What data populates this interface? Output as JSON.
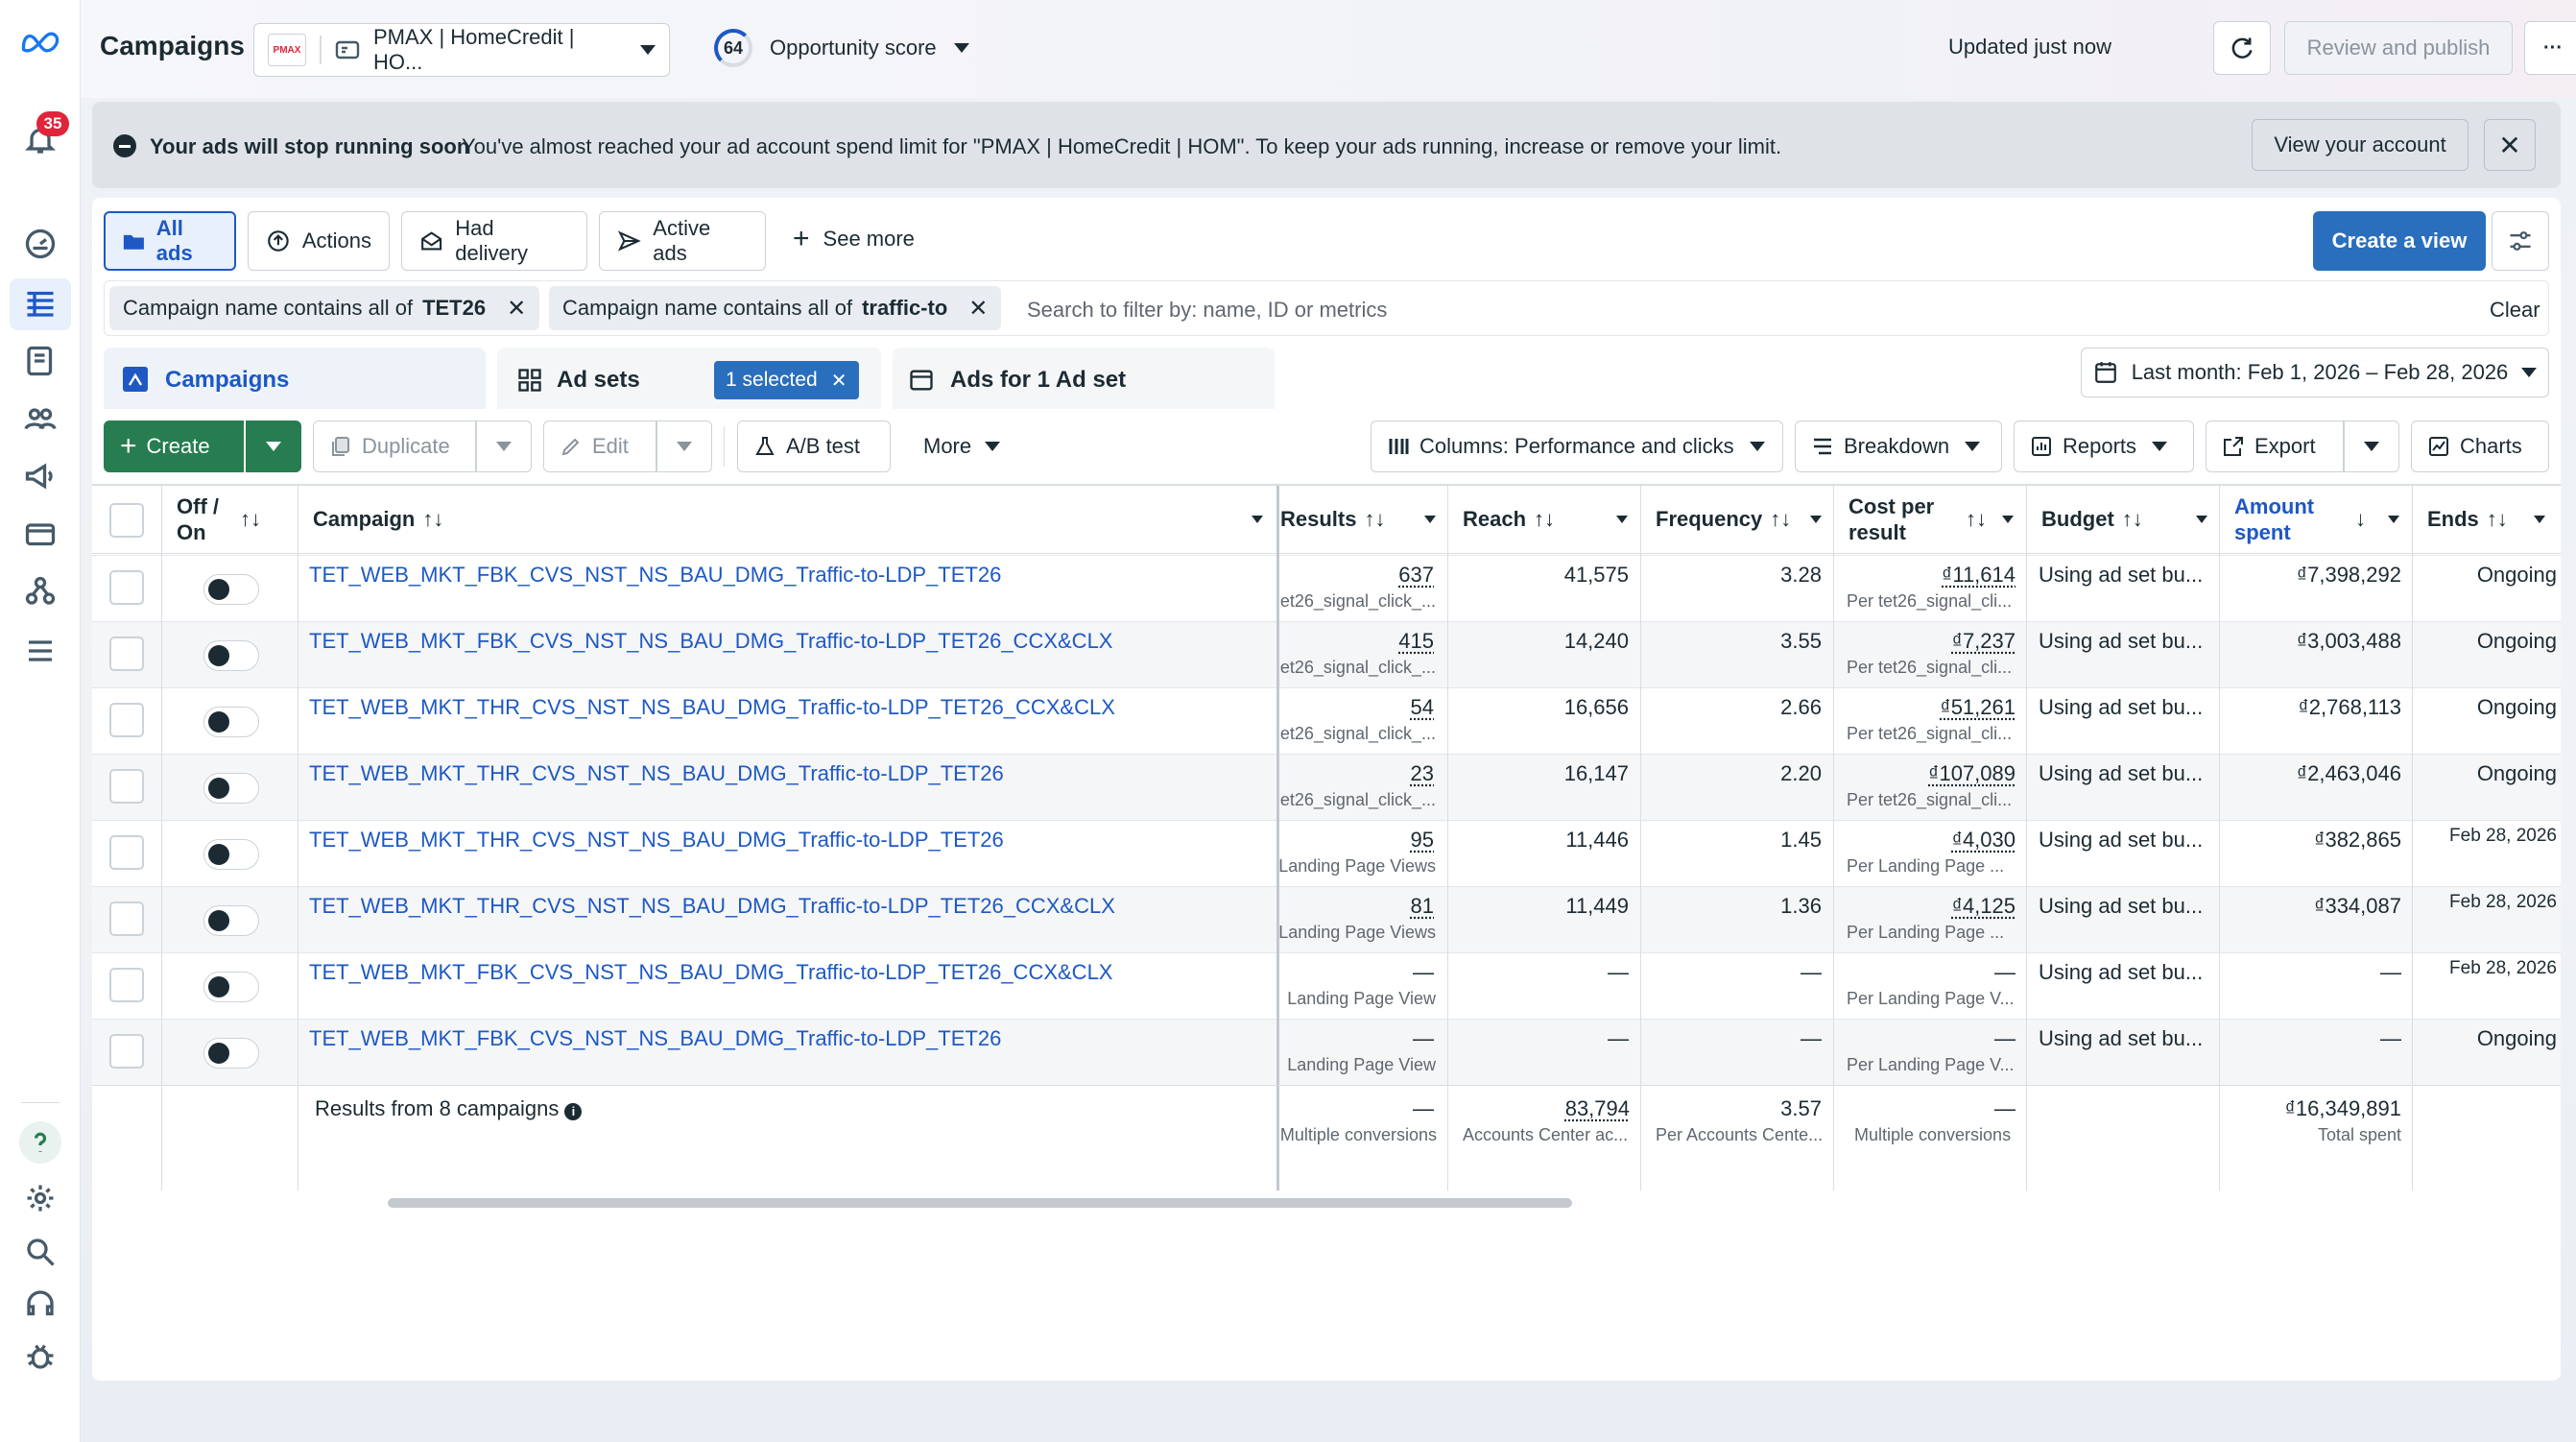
{
  "header": {
    "title": "Campaigns",
    "account_name": "PMAX | HomeCredit | HO...",
    "account_logo_text": "PMAX",
    "opportunity_score": "64",
    "opportunity_label": "Opportunity score",
    "updated": "Updated just now",
    "review_publish": "Review and publish",
    "more": "···"
  },
  "rail": {
    "notifications": "35"
  },
  "banner": {
    "title": "Your ads will stop running soon",
    "message": "You've almost reached your ad account spend limit for \"PMAX | HomeCredit | HOM\". To keep your ads running, increase or remove your limit.",
    "view_account": "View your account"
  },
  "views": {
    "all_ads": "All ads",
    "actions": "Actions",
    "had_delivery": "Had delivery",
    "active_ads": "Active ads",
    "see_more": "See more",
    "create_view": "Create a view"
  },
  "filters": [
    {
      "prefix": "Campaign name contains all of",
      "value": "TET26"
    },
    {
      "prefix": "Campaign name contains all of",
      "value": "traffic-to"
    }
  ],
  "search": {
    "placeholder": "Search to filter by: name, ID or metrics",
    "clear": "Clear"
  },
  "level_tabs": {
    "campaigns": "Campaigns",
    "ad_sets": "Ad sets",
    "selected": "1 selected",
    "ads": "Ads for 1 Ad set"
  },
  "date_range": "Last month: Feb 1, 2026 – Feb 28, 2026",
  "toolbar": {
    "create": "Create",
    "duplicate": "Duplicate",
    "edit": "Edit",
    "ab_test": "A/B test",
    "more": "More",
    "columns": "Columns: Performance and clicks",
    "breakdown": "Breakdown",
    "reports": "Reports",
    "export": "Export",
    "charts": "Charts"
  },
  "table": {
    "headers": {
      "off_on": "Off /\nOn",
      "campaign": "Campaign",
      "results": "Results",
      "reach": "Reach",
      "frequency": "Frequency",
      "cost_per_result": "Cost per\nresult",
      "budget": "Budget",
      "amount_spent": "Amount\nspent",
      "ends": "Ends"
    },
    "rows": [
      {
        "campaign": "TET_WEB_MKT_FBK_CVS_NST_NS_BAU_DMG_Traffic-to-LDP_TET26",
        "results": "637",
        "results_sub": "et26_signal_click_...",
        "reach": "41,575",
        "frequency": "3.28",
        "cpr": "₫11,614",
        "cpr_sub": "Per tet26_signal_cli...",
        "budget": "Using ad set bu...",
        "spent": "₫7,398,292",
        "ends": "Ongoing"
      },
      {
        "campaign": "TET_WEB_MKT_FBK_CVS_NST_NS_BAU_DMG_Traffic-to-LDP_TET26_CCX&CLX",
        "results": "415",
        "results_sub": "et26_signal_click_...",
        "reach": "14,240",
        "frequency": "3.55",
        "cpr": "₫7,237",
        "cpr_sub": "Per tet26_signal_cli...",
        "budget": "Using ad set bu...",
        "spent": "₫3,003,488",
        "ends": "Ongoing"
      },
      {
        "campaign": "TET_WEB_MKT_THR_CVS_NST_NS_BAU_DMG_Traffic-to-LDP_TET26_CCX&CLX",
        "results": "54",
        "results_sub": "et26_signal_click_...",
        "reach": "16,656",
        "frequency": "2.66",
        "cpr": "₫51,261",
        "cpr_sub": "Per tet26_signal_cli...",
        "budget": "Using ad set bu...",
        "spent": "₫2,768,113",
        "ends": "Ongoing"
      },
      {
        "campaign": "TET_WEB_MKT_THR_CVS_NST_NS_BAU_DMG_Traffic-to-LDP_TET26",
        "results": "23",
        "results_sub": "et26_signal_click_...",
        "reach": "16,147",
        "frequency": "2.20",
        "cpr": "₫107,089",
        "cpr_sub": "Per tet26_signal_cli...",
        "budget": "Using ad set bu...",
        "spent": "₫2,463,046",
        "ends": "Ongoing"
      },
      {
        "campaign": "TET_WEB_MKT_THR_CVS_NST_NS_BAU_DMG_Traffic-to-LDP_TET26",
        "results": "95",
        "results_sub": "Landing Page Views",
        "reach": "11,446",
        "frequency": "1.45",
        "cpr": "₫4,030",
        "cpr_sub": "Per Landing Page ...",
        "budget": "Using ad set bu...",
        "spent": "₫382,865",
        "ends": "Feb 28, 2026"
      },
      {
        "campaign": "TET_WEB_MKT_THR_CVS_NST_NS_BAU_DMG_Traffic-to-LDP_TET26_CCX&CLX",
        "results": "81",
        "results_sub": "Landing Page Views",
        "reach": "11,449",
        "frequency": "1.36",
        "cpr": "₫4,125",
        "cpr_sub": "Per Landing Page ...",
        "budget": "Using ad set bu...",
        "spent": "₫334,087",
        "ends": "Feb 28, 2026"
      },
      {
        "campaign": "TET_WEB_MKT_FBK_CVS_NST_NS_BAU_DMG_Traffic-to-LDP_TET26_CCX&CLX",
        "results": "—",
        "results_sub": "Landing Page View",
        "reach": "—",
        "frequency": "—",
        "cpr": "—",
        "cpr_sub": "Per Landing Page V...",
        "budget": "Using ad set bu...",
        "spent": "—",
        "ends": "Feb 28, 2026"
      },
      {
        "campaign": "TET_WEB_MKT_FBK_CVS_NST_NS_BAU_DMG_Traffic-to-LDP_TET26",
        "results": "—",
        "results_sub": "Landing Page View",
        "reach": "—",
        "frequency": "—",
        "cpr": "—",
        "cpr_sub": "Per Landing Page V...",
        "budget": "Using ad set bu...",
        "spent": "—",
        "ends": "Ongoing"
      }
    ],
    "summary": {
      "label": "Results from 8 campaigns",
      "results": "—",
      "results_sub": "Multiple conversions",
      "reach": "83,794",
      "reach_sub": "Accounts Center ac...",
      "frequency": "3.57",
      "frequency_sub": "Per Accounts Cente...",
      "cpr": "—",
      "cpr_sub": "Multiple conversions",
      "spent": "₫16,349,891",
      "spent_sub": "Total spent"
    }
  },
  "colors": {
    "accent": "#1d58c4",
    "primary_button": "#2a6fbd",
    "create_button": "#277d4f",
    "badge": "#e0243a"
  }
}
